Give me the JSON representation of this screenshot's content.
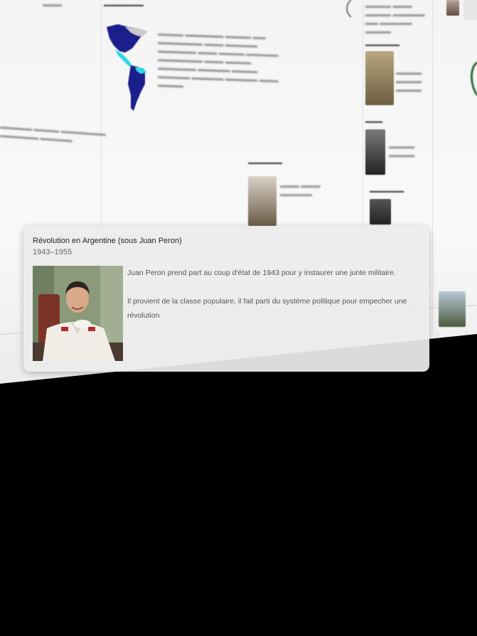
{
  "popup": {
    "title": "Révolution en Argentine (sous Juan Peron)",
    "date": "1943–1955",
    "photo_subject": "Juan Peron portrait",
    "paragraphs": [
      "Juan Peron prend part au coup d'état de 1943 pour y instaurer une junte militaire.",
      "Il provient de la classe populaire, il fait parti du système politique pour empecher une révolution"
    ]
  },
  "background": {
    "map_subject": "map-of-the-americas",
    "colors": {
      "map_blue": "#1b1f8c",
      "map_cyan": "#2fd6e8",
      "map_grey": "#c9c9c9",
      "black_floor": "#000000"
    }
  }
}
